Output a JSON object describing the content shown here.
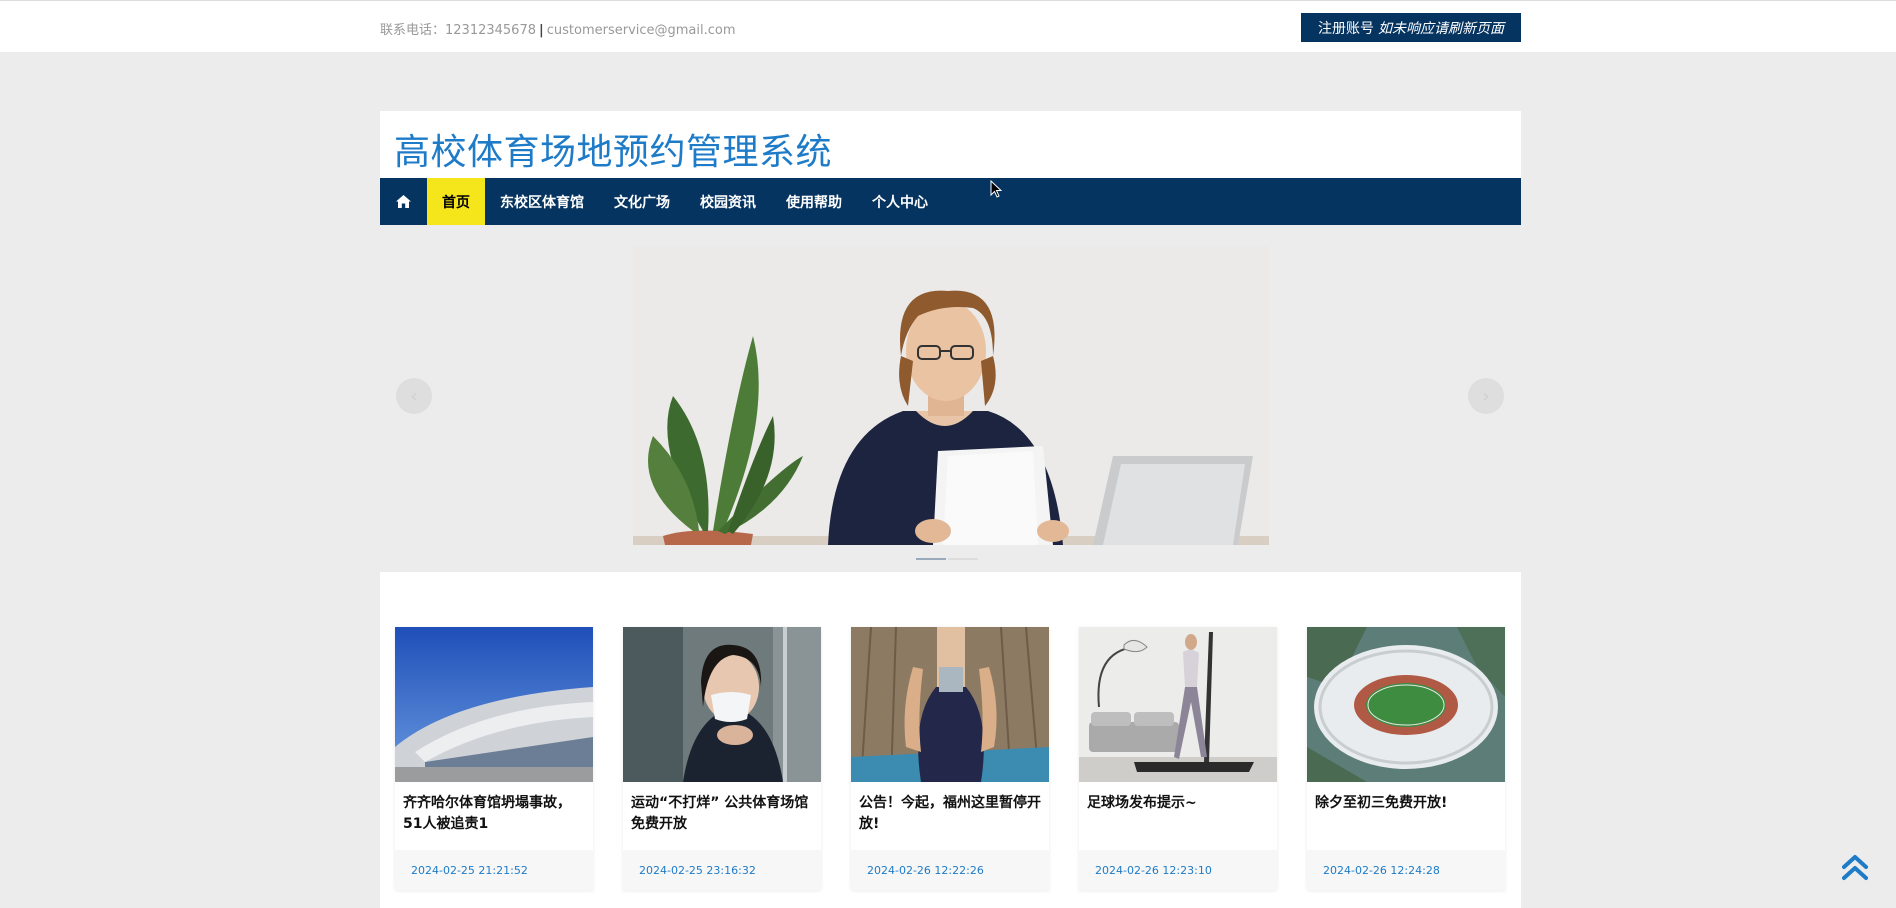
{
  "topbar": {
    "contact_label": "联系电话：12312345678",
    "separator": "|",
    "email": "customerservice@gmail.com",
    "register_label": "注册账号",
    "register_note": "如未响应请刷新页面"
  },
  "header": {
    "title": "高校体育场地预约管理系统"
  },
  "nav": {
    "home_icon": "home-icon",
    "items": [
      {
        "label": "首页",
        "active": true
      },
      {
        "label": "东校区体育馆"
      },
      {
        "label": "文化广场"
      },
      {
        "label": "校园资讯"
      },
      {
        "label": "使用帮助"
      },
      {
        "label": "个人中心"
      }
    ]
  },
  "carousel": {
    "prev": "‹",
    "next": "›",
    "slide_count": 2,
    "active_index": 0
  },
  "news": [
    {
      "title": "齐齐哈尔体育馆坍塌事故，51人被追责1",
      "date": "2024-02-25 21:21:52"
    },
    {
      "title": "运动“不打烊” 公共体育场馆免费开放",
      "date": "2024-02-25 23:16:32"
    },
    {
      "title": "公告！今起，福州这里暂停开放!",
      "date": "2024-02-26 12:22:26"
    },
    {
      "title": "足球场发布提示~",
      "date": "2024-02-26 12:23:10"
    },
    {
      "title": "除夕至初三免费开放!",
      "date": "2024-02-26 12:24:28"
    }
  ],
  "colors": {
    "navy": "#063461",
    "active_yellow": "#f5e61c",
    "title_blue": "#1e7bc8"
  }
}
